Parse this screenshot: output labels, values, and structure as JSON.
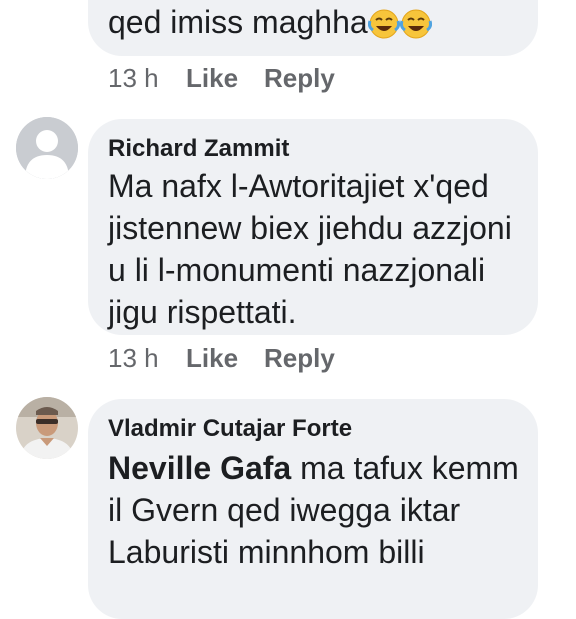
{
  "comments": [
    {
      "lines": [
        "qed imiss maghha"
      ],
      "emoji_icons": [
        "face-with-tears-of-joy-icon",
        "face-with-tears-of-joy-icon"
      ],
      "time": "13 h",
      "like_label": "Like",
      "reply_label": "Reply"
    },
    {
      "author": "Richard Zammit",
      "lines": [
        "Ma nafx  l-Awtoritajiet x'qed",
        "jistennew biex jiehdu azzjoni",
        "u li l-monumenti nazzjonali",
        "jigu rispettati."
      ],
      "time": "13 h",
      "like_label": "Like",
      "reply_label": "Reply"
    },
    {
      "author": "Vladmir Cutajar Forte",
      "mention": "Neville Gafa",
      "lines": [
        " ma tafux kemm",
        "il Gvern qed iwegga iktar",
        "Laburisti minnhom billi"
      ],
      "time": "",
      "like_label": "",
      "reply_label": ""
    }
  ],
  "colors": {
    "bubble": "#eff1f4",
    "meta_text": "#65676b",
    "body_text": "#1c1e21"
  }
}
